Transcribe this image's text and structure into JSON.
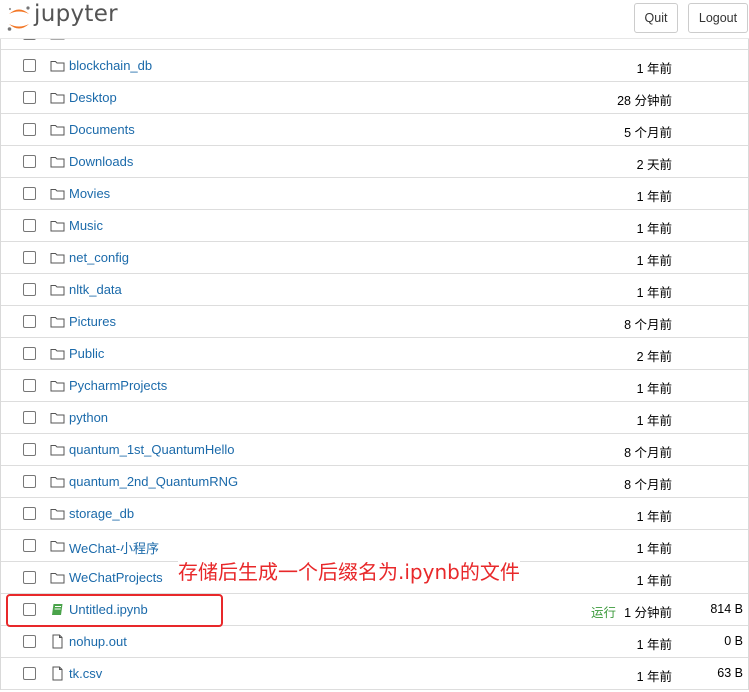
{
  "header": {
    "logo_text": "jupyter",
    "quit_label": "Quit",
    "logout_label": "Logout"
  },
  "files": [
    {
      "name": "",
      "type": "folder",
      "modified": "",
      "size": "",
      "running": ""
    },
    {
      "name": "blockchain_db",
      "type": "folder",
      "modified": "1 年前",
      "size": "",
      "running": ""
    },
    {
      "name": "Desktop",
      "type": "folder",
      "modified": "28 分钟前",
      "size": "",
      "running": ""
    },
    {
      "name": "Documents",
      "type": "folder",
      "modified": "5 个月前",
      "size": "",
      "running": ""
    },
    {
      "name": "Downloads",
      "type": "folder",
      "modified": "2 天前",
      "size": "",
      "running": ""
    },
    {
      "name": "Movies",
      "type": "folder",
      "modified": "1 年前",
      "size": "",
      "running": ""
    },
    {
      "name": "Music",
      "type": "folder",
      "modified": "1 年前",
      "size": "",
      "running": ""
    },
    {
      "name": "net_config",
      "type": "folder",
      "modified": "1 年前",
      "size": "",
      "running": ""
    },
    {
      "name": "nltk_data",
      "type": "folder",
      "modified": "1 年前",
      "size": "",
      "running": ""
    },
    {
      "name": "Pictures",
      "type": "folder",
      "modified": "8 个月前",
      "size": "",
      "running": ""
    },
    {
      "name": "Public",
      "type": "folder",
      "modified": "2 年前",
      "size": "",
      "running": ""
    },
    {
      "name": "PycharmProjects",
      "type": "folder",
      "modified": "1 年前",
      "size": "",
      "running": ""
    },
    {
      "name": "python",
      "type": "folder",
      "modified": "1 年前",
      "size": "",
      "running": ""
    },
    {
      "name": "quantum_1st_QuantumHello",
      "type": "folder",
      "modified": "8 个月前",
      "size": "",
      "running": ""
    },
    {
      "name": "quantum_2nd_QuantumRNG",
      "type": "folder",
      "modified": "8 个月前",
      "size": "",
      "running": ""
    },
    {
      "name": "storage_db",
      "type": "folder",
      "modified": "1 年前",
      "size": "",
      "running": ""
    },
    {
      "name": "WeChat-小程序",
      "type": "folder",
      "modified": "1 年前",
      "size": "",
      "running": ""
    },
    {
      "name": "WeChatProjects",
      "type": "folder",
      "modified": "1 年前",
      "size": "",
      "running": ""
    },
    {
      "name": "Untitled.ipynb",
      "type": "notebook",
      "modified": "1 分钟前",
      "size": "814 B",
      "running": "运行"
    },
    {
      "name": "nohup.out",
      "type": "file",
      "modified": "1 年前",
      "size": "0 B",
      "running": ""
    },
    {
      "name": "tk.csv",
      "type": "file",
      "modified": "1 年前",
      "size": "63 B",
      "running": ""
    }
  ],
  "annotation": {
    "text": "存储后生成一个后缀名为.ipynb的文件",
    "color": "#e8282a"
  },
  "colors": {
    "link": "#1b6aaa",
    "running": "#3c9a3c",
    "notebook_icon": "#4aa34a",
    "logo_orange": "#f37726"
  }
}
